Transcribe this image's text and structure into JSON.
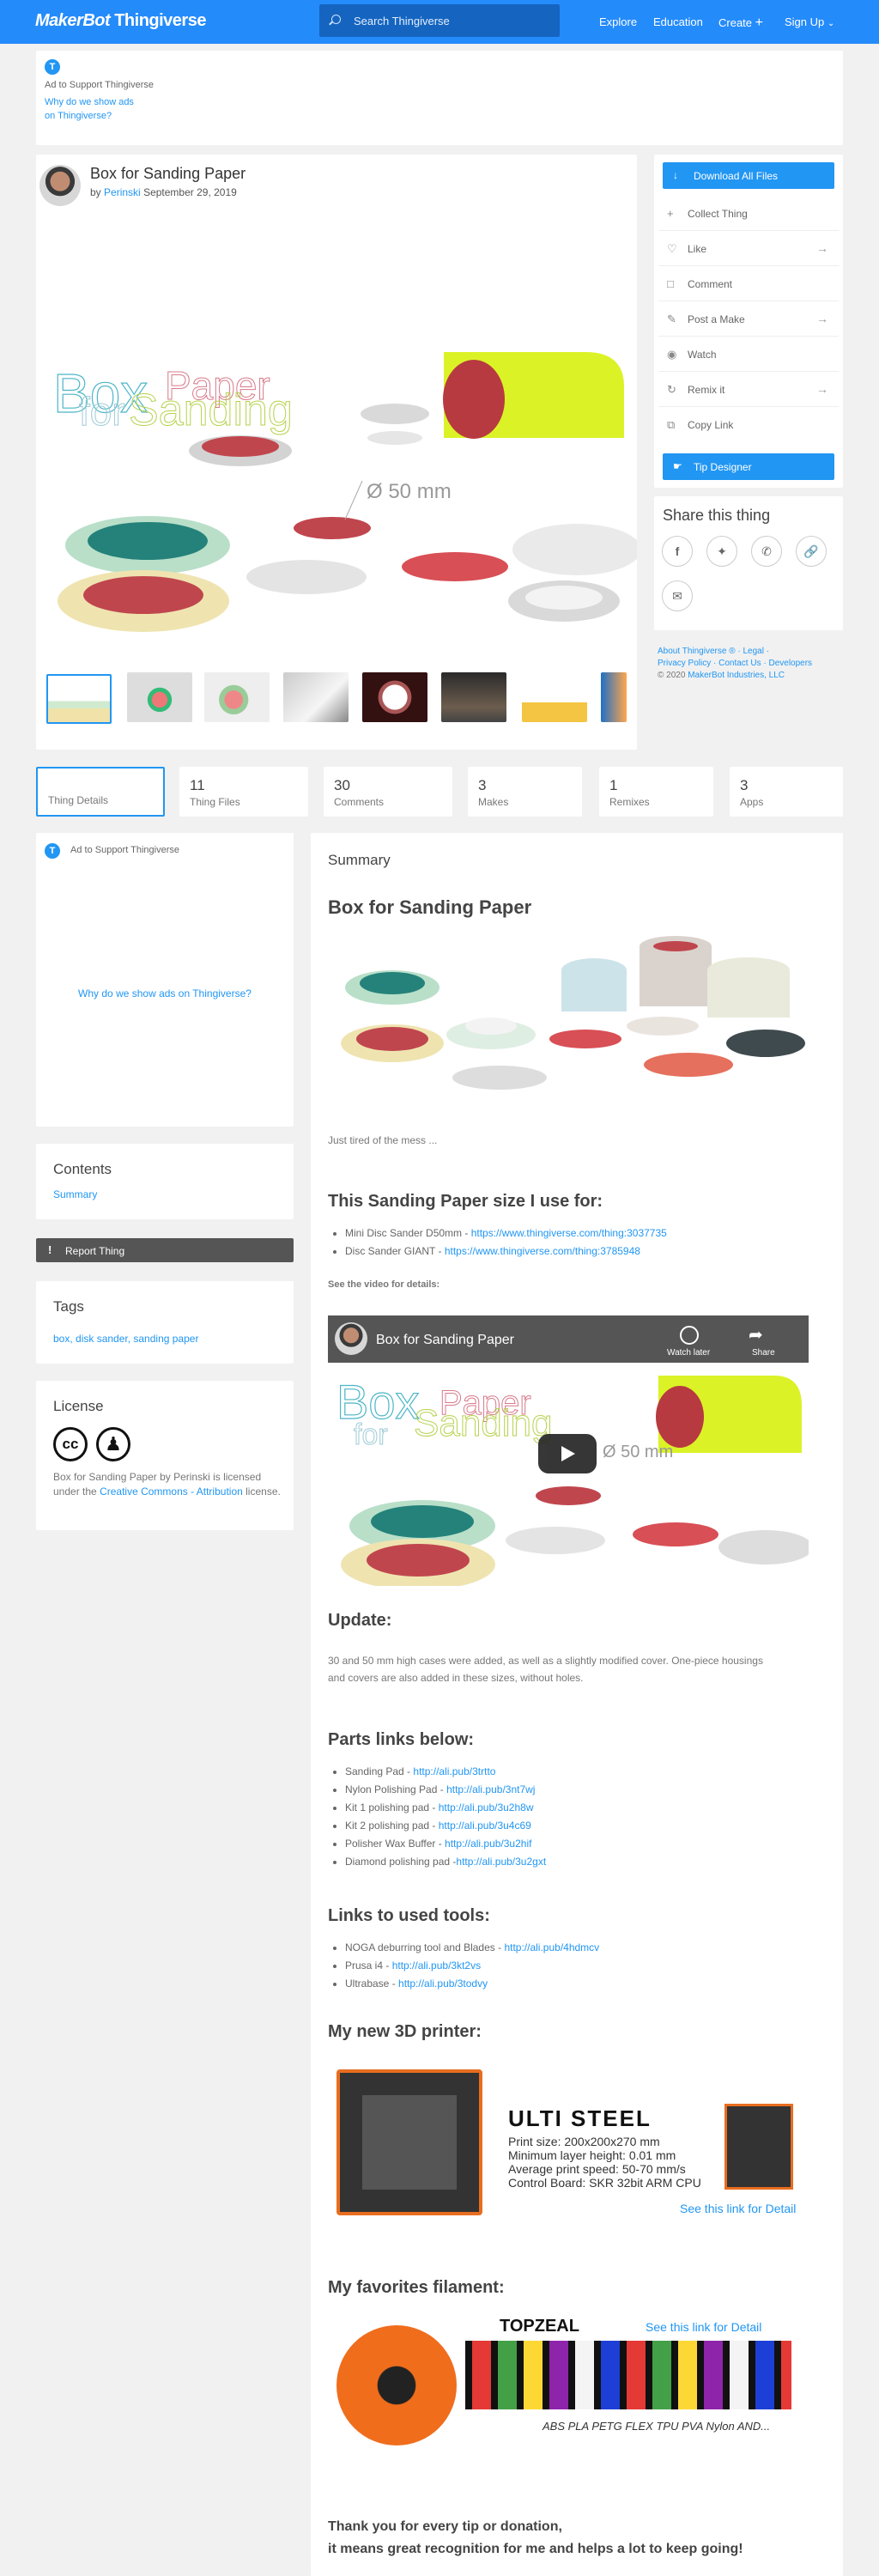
{
  "header": {
    "logo_brand": "MakerBot",
    "logo_product": "Thingiverse",
    "search_placeholder": "Search Thingiverse",
    "nav": [
      "Explore",
      "Education",
      "Create",
      "Sign Up"
    ]
  },
  "top_ad": {
    "badge": "T",
    "label": "Ad to Support Thingiverse",
    "why_line1": "Why do we show ads",
    "why_line2": "on Thingiverse?"
  },
  "thing": {
    "title": "Box for Sanding Paper",
    "by": "by",
    "author": "Perinski",
    "date": "September 29, 2019",
    "hero": {
      "word_box": "Box",
      "word_for": "for",
      "word_paper": "Paper",
      "word_sanding": "Sanding",
      "dimension": "Ø 50 mm"
    }
  },
  "actions": {
    "download": "Download All Files",
    "items": [
      "Collect Thing",
      "Like",
      "Comment",
      "Post a Make",
      "Watch",
      "Remix it",
      "Copy Link"
    ],
    "tip": "Tip Designer",
    "share_title": "Share this thing"
  },
  "footer_links": {
    "line1": "About Thingiverse ® · Legal ·",
    "line2": "Privacy Policy · Contact Us · Developers",
    "copyright": "© 2020",
    "company": "MakerBot Industries, LLC"
  },
  "tabs": [
    {
      "count": "",
      "label": "Thing Details"
    },
    {
      "count": "11",
      "label": "Thing Files"
    },
    {
      "count": "30",
      "label": "Comments"
    },
    {
      "count": "3",
      "label": "Makes"
    },
    {
      "count": "1",
      "label": "Remixes"
    },
    {
      "count": "3",
      "label": "Apps"
    }
  ],
  "side": {
    "ad_label": "Ad to Support Thingiverse",
    "ad_why": "Why do we show ads on Thingiverse?",
    "contents_title": "Contents",
    "contents_link": "Summary",
    "report": "Report Thing",
    "tags_title": "Tags",
    "tags": "box, disk sander, sanding paper",
    "license_title": "License",
    "license_text1": "Box for Sanding Paper by Perinski is licensed",
    "license_text2": "under the",
    "license_link": "Creative Commons - Attribution",
    "license_text3": "license."
  },
  "summary": {
    "label": "Summary",
    "title": "Box for Sanding Paper",
    "intro": "Just tired of the mess ...",
    "size_heading": "This Sanding Paper size I use for:",
    "sizes": [
      {
        "text": "Mini Disc Sander D50mm - ",
        "url": "https://www.thingiverse.com/thing:3037735"
      },
      {
        "text": "Disc Sander GIANT - ",
        "url": "https://www.thingiverse.com/thing:3785948"
      }
    ],
    "video_label": "See the video for details:",
    "video_title": "Box for Sanding Paper",
    "video_later": "Watch later",
    "video_share": "Share",
    "update_heading": "Update:",
    "update_line1": "30 and 50 mm high cases were added, as well as a slightly modified cover. One-piece housings",
    "update_line2": "and covers are also added in these sizes, without holes.",
    "parts_heading": "Parts links below:",
    "parts": [
      {
        "text": "Sanding Pad - ",
        "url": "http://ali.pub/3trtto"
      },
      {
        "text": "Nylon Polishing Pad - ",
        "url": "http://ali.pub/3nt7wj"
      },
      {
        "text": "Kit 1 polishing pad - ",
        "url": "http://ali.pub/3u2h8w"
      },
      {
        "text": "Kit 2 polishing pad - ",
        "url": "http://ali.pub/3u4c69"
      },
      {
        "text": "Polisher Wax Buffer - ",
        "url": "http://ali.pub/3u2hif"
      },
      {
        "text": "Diamond polishing pad -",
        "url": "http://ali.pub/3u2gxt"
      }
    ],
    "tools_heading": "Links to used tools:",
    "tools": [
      {
        "text": "NOGA deburring tool and Blades - ",
        "url": "http://ali.pub/4hdmcv"
      },
      {
        "text": "Prusa i4 - ",
        "url": "http://ali.pub/3kt2vs"
      },
      {
        "text": "Ultrabase - ",
        "url": "http://ali.pub/3todvy"
      }
    ],
    "printer_heading": "My new 3D printer:",
    "printer": {
      "name": "ULTI STEEL",
      "spec1": "Print size: 200x200x270 mm",
      "spec2": "Minimum layer height: 0.01 mm",
      "spec3": "Average print speed: 50-70 mm/s",
      "spec4": "Control Board: SKR 32bit ARM CPU",
      "link": "See this link for Detail"
    },
    "filament_heading": "My favorites filament:",
    "filament": {
      "brand": "TOPZEAL",
      "link": "See this link for Detail",
      "types": "ABS PLA PETG FLEX TPU PVA Nylon AND..."
    },
    "thanks_line1": "Thank you for every tip or donation,",
    "thanks_line2": "it means great recognition for me and helps a lot to keep going!"
  },
  "colors": {
    "brand_blue": "#248bfb",
    "link_blue": "#2196f3",
    "page_bg": "#f1f1f1"
  }
}
